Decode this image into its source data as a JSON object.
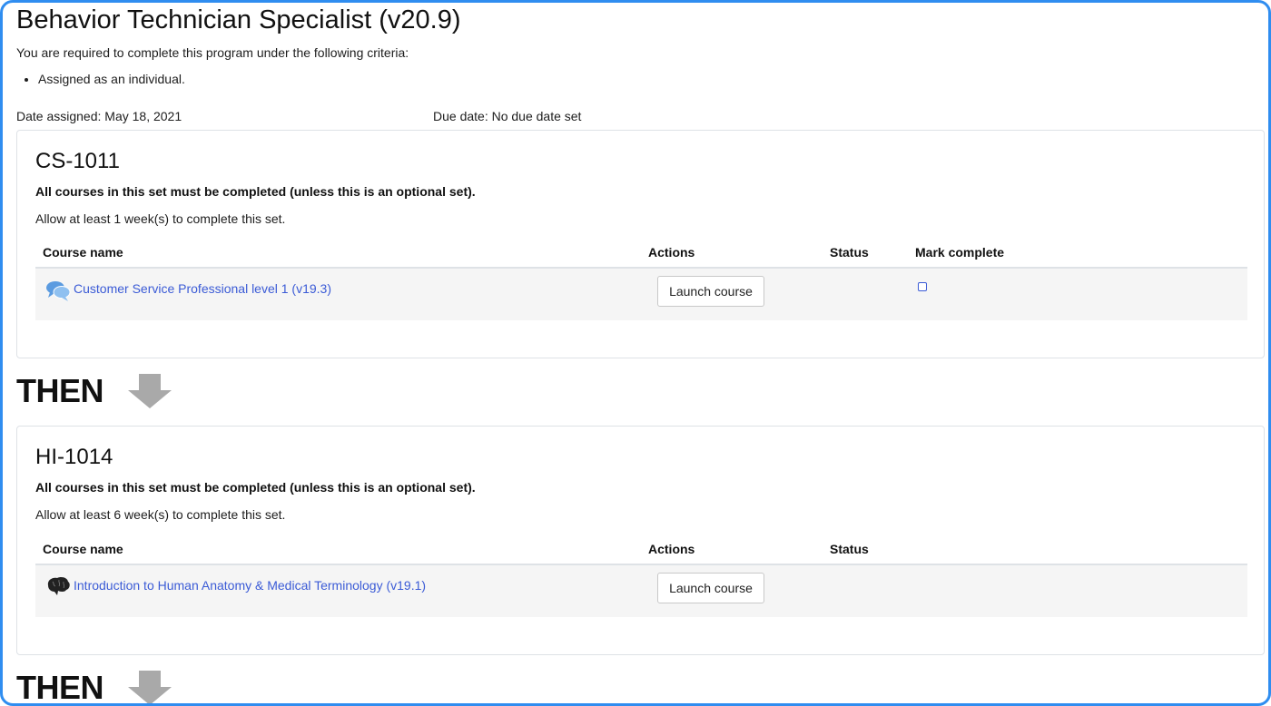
{
  "program": {
    "title": "Behavior Technician Specialist (v20.9)",
    "criteria_intro": "You are required to complete this program under the following criteria:",
    "criteria": [
      "Assigned as an individual."
    ],
    "date_assigned": "Date assigned: May 18, 2021",
    "due_date": "Due date: No due date set"
  },
  "columns": {
    "course_name": "Course name",
    "actions": "Actions",
    "status": "Status",
    "mark_complete": "Mark complete"
  },
  "sets": [
    {
      "code": "CS-1011",
      "requirement": "All courses in this set must be completed (unless this is an optional set).",
      "allow": "Allow at least 1 week(s) to complete this set.",
      "courses": [
        {
          "name": "Customer Service Professional level 1 (v19.3)",
          "icon": "speech-bubbles-icon",
          "action_label": "Launch course",
          "status": "",
          "mark_complete": false
        }
      ]
    },
    {
      "code": "HI-1014",
      "requirement": "All courses in this set must be completed (unless this is an optional set).",
      "allow": "Allow at least 6 week(s) to complete this set.",
      "courses": [
        {
          "name": "Introduction to Human Anatomy & Medical Terminology (v19.1)",
          "icon": "brain-icon",
          "action_label": "Launch course",
          "status": ""
        }
      ]
    }
  ],
  "then_label": "THEN",
  "colors": {
    "frame_border": "#2f8df0",
    "link": "#3b5bd6",
    "arrow": "#a9a9a9",
    "row_bg": "#f5f5f5"
  }
}
